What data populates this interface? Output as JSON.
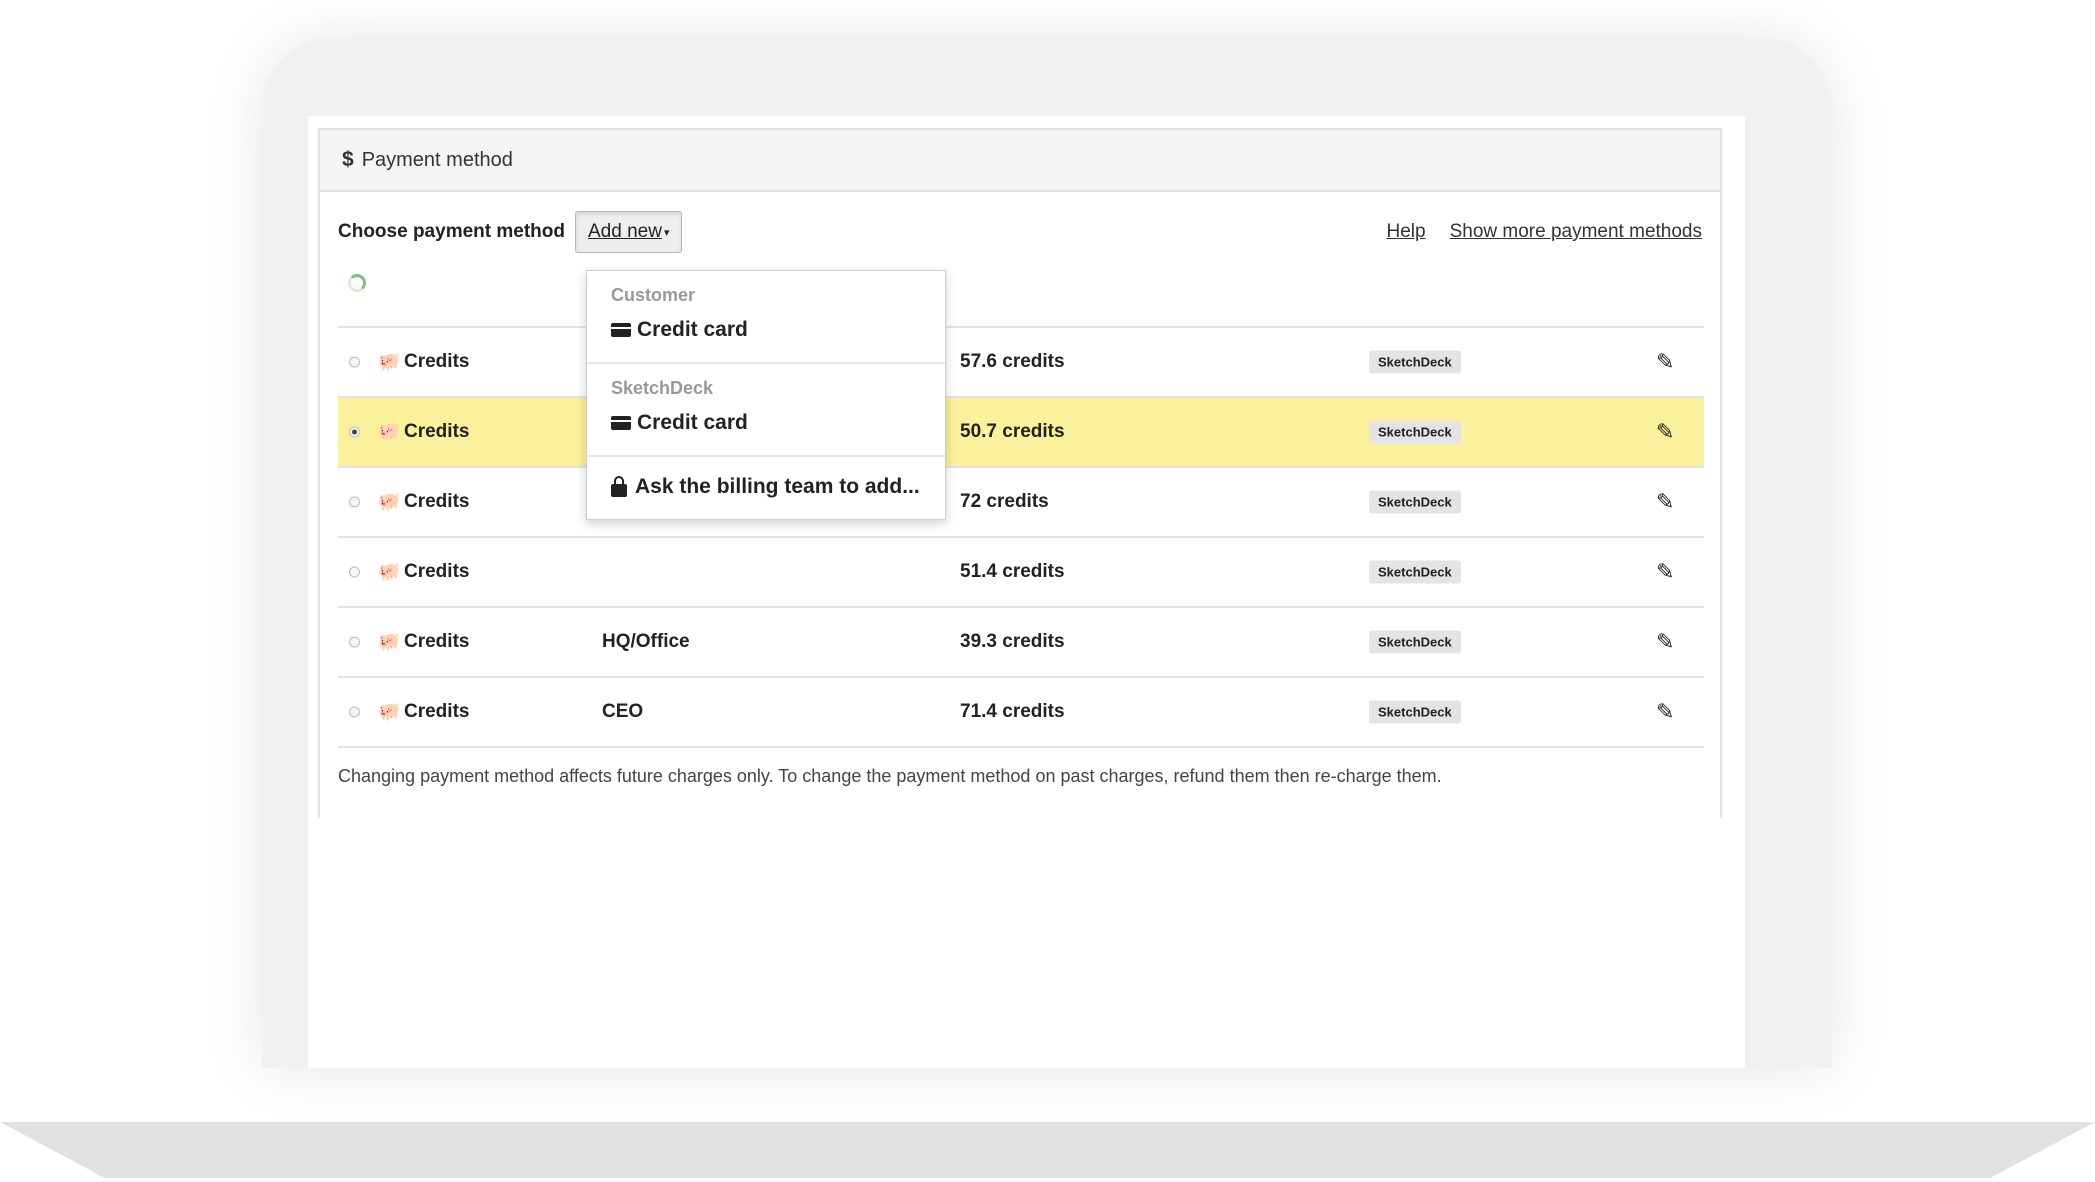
{
  "panel": {
    "title": "Payment method",
    "dollar_symbol": "$"
  },
  "toolbar": {
    "choose_label": "Choose payment method",
    "add_new_label": "Add new",
    "help_label": "Help",
    "show_more_label": "Show more payment methods"
  },
  "dropdown": {
    "sections": [
      {
        "header": "Customer",
        "items": [
          {
            "icon": "credit-card-icon",
            "label": "Credit card"
          }
        ]
      },
      {
        "header": "SketchDeck",
        "items": [
          {
            "icon": "credit-card-icon",
            "label": "Credit card"
          }
        ]
      },
      {
        "header": "",
        "items": [
          {
            "icon": "lock-icon",
            "label": "Ask the billing team to add..."
          }
        ]
      }
    ]
  },
  "rows": [
    {
      "type": "Credits",
      "name": "",
      "amount": "57.6 credits",
      "badge": "SketchDeck",
      "selected": false
    },
    {
      "type": "Credits",
      "name": "",
      "amount": "50.7 credits",
      "badge": "SketchDeck",
      "selected": true
    },
    {
      "type": "Credits",
      "name": "",
      "amount": "72 credits",
      "badge": "SketchDeck",
      "selected": false
    },
    {
      "type": "Credits",
      "name": "",
      "amount": "51.4 credits",
      "badge": "SketchDeck",
      "selected": false
    },
    {
      "type": "Credits",
      "name": "HQ/Office",
      "amount": "39.3 credits",
      "badge": "SketchDeck",
      "selected": false
    },
    {
      "type": "Credits",
      "name": "CEO",
      "amount": "71.4 credits",
      "badge": "SketchDeck",
      "selected": false
    }
  ],
  "footnote": "Changing payment method affects future charges only. To change the payment method on past charges, refund them then re-charge them.",
  "colors": {
    "selected_row": "#fbf09c",
    "badge_bg": "#e4e4e4",
    "spinner": "#7ac17a"
  }
}
